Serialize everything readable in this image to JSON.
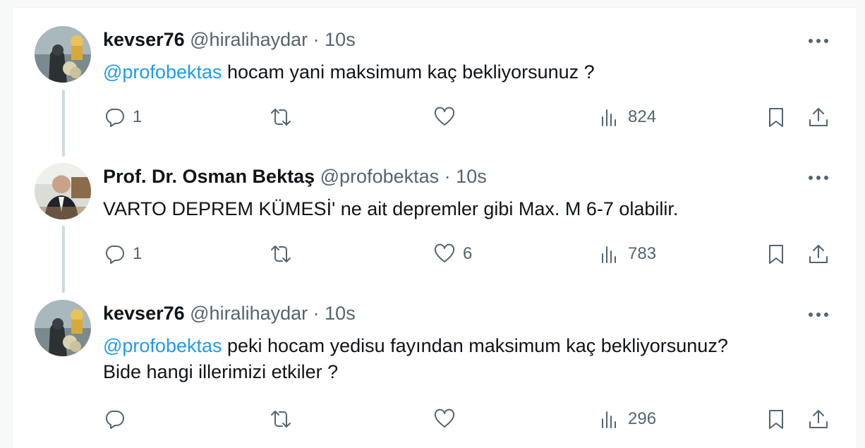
{
  "tweets": [
    {
      "name": "kevser76",
      "handle": "@hiralihaydar",
      "separator": "·",
      "time": "10s",
      "mention": "@profobektas",
      "text": " hocam yani maksimum kaç bekliyorsunuz ?",
      "text_line2": "",
      "reply_count": "1",
      "retweet_count": "",
      "like_count": "",
      "view_count": "824"
    },
    {
      "name": "Prof. Dr. Osman Bektaş",
      "handle": "@profobektas",
      "separator": "·",
      "time": "10s",
      "mention": "",
      "text": "VARTO DEPREM KÜMESİ' ne ait depremler gibi Max. M 6-7 olabilir.",
      "text_line2": "",
      "reply_count": "1",
      "retweet_count": "",
      "like_count": "6",
      "view_count": "783"
    },
    {
      "name": "kevser76",
      "handle": "@hiralihaydar",
      "separator": "·",
      "time": "10s",
      "mention": "@profobektas",
      "text": " peki hocam yedisu fayından maksimum kaç bekliyorsunuz?",
      "text_line2": "Bide hangi illerimizi etkiler ?",
      "reply_count": "",
      "retweet_count": "",
      "like_count": "",
      "view_count": "296"
    }
  ],
  "icons": {
    "reply": "reply-icon",
    "retweet": "retweet-icon",
    "like": "heart-icon",
    "views": "views-icon",
    "bookmark": "bookmark-icon",
    "share": "share-icon",
    "more": "more-icon"
  },
  "colors": {
    "link": "#1d9bf0",
    "secondary_text": "#536471",
    "thread_line": "#cfd9de"
  }
}
